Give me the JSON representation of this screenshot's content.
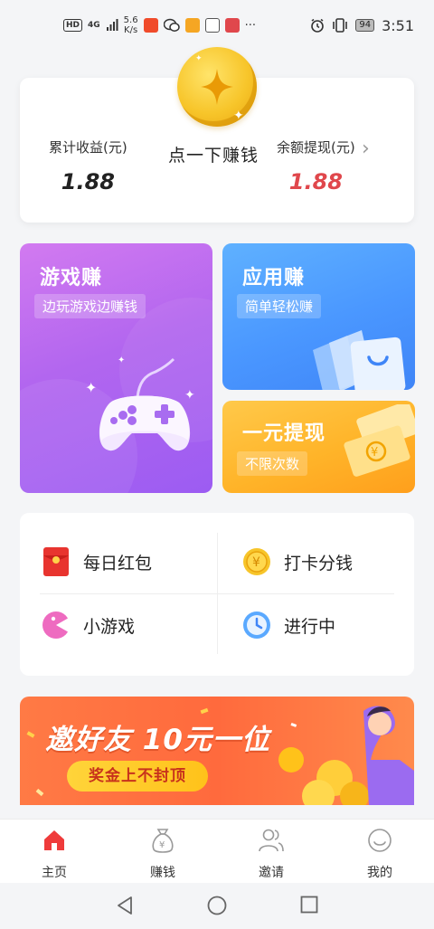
{
  "status_bar": {
    "hd": "HD",
    "network": "4G",
    "speed_value": "5.6",
    "speed_unit": "K/s",
    "more": "···",
    "battery": "94",
    "time": "3:51"
  },
  "summary": {
    "total_earnings_label": "累计收益(元)",
    "total_earnings_value": "1.88",
    "tap_to_earn": "点一下赚钱",
    "balance_label": "余额提现(元)",
    "balance_value": "1.88"
  },
  "cards": {
    "game": {
      "title": "游戏赚",
      "subtitle": "边玩游戏边赚钱"
    },
    "app": {
      "title": "应用赚",
      "subtitle": "简单轻松赚"
    },
    "cash": {
      "title": "一元提现",
      "subtitle": "不限次数"
    }
  },
  "menu": {
    "daily_red_packet": "每日红包",
    "check_in_split": "打卡分钱",
    "mini_game": "小游戏",
    "in_progress": "进行中"
  },
  "banner": {
    "title": "邀好友 10元一位",
    "pill": "奖金上不封顶"
  },
  "bottom_nav": {
    "home": "主页",
    "earn": "赚钱",
    "invite": "邀请",
    "mine": "我的"
  },
  "colors": {
    "accent_red": "#e0474c",
    "game_card": "#b266ef",
    "app_card": "#4a97ff",
    "cash_card": "#ffb429",
    "banner": "#ff6a3d"
  }
}
